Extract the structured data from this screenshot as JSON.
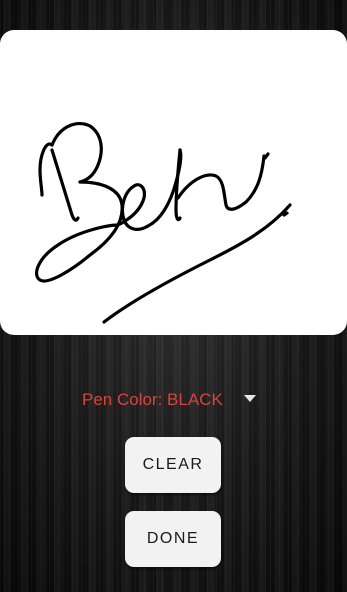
{
  "signature_pad": {
    "background": "#ffffff",
    "stroke_color": "#000000"
  },
  "pen_color": {
    "label": "Pen Color: BLACK",
    "label_color": "#d8443c",
    "arrow_icon": "dropdown-triangle"
  },
  "buttons": {
    "clear_label": "CLEAR",
    "done_label": "DONE"
  }
}
